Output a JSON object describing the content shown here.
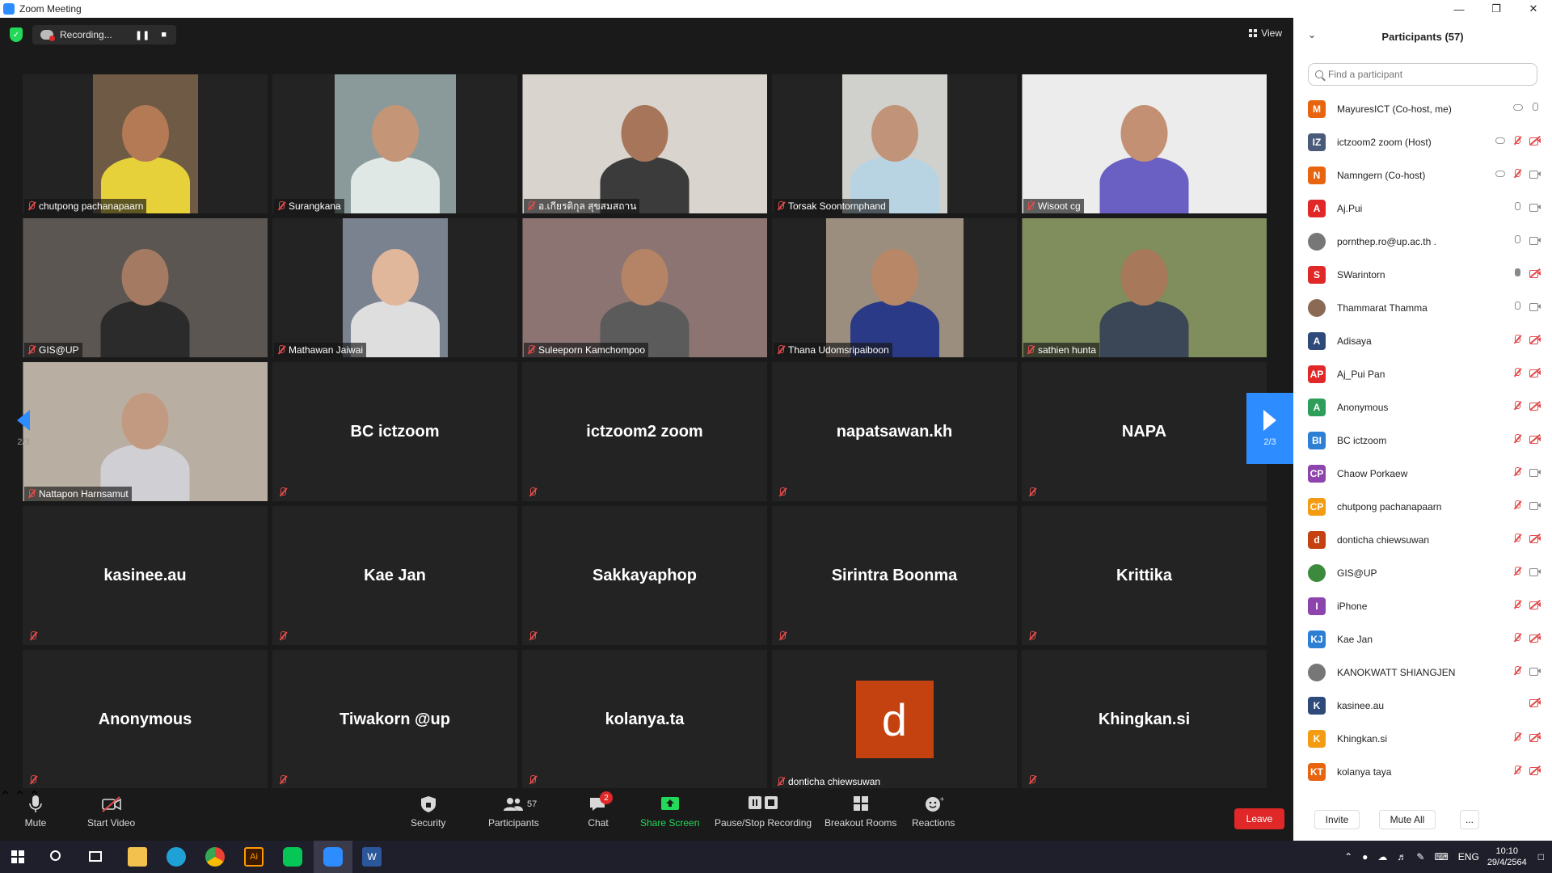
{
  "window": {
    "title": "Zoom Meeting"
  },
  "topbar": {
    "recording_label": "Recording...",
    "view_label": "View"
  },
  "pager": {
    "page": "2/3"
  },
  "tiles": [
    {
      "name": "chutpong pachanapaarn",
      "video": true,
      "bg": "#6e5a45",
      "skin": "#b37a55",
      "shirt": "#e6d13a"
    },
    {
      "name": "Surangkana",
      "video": true,
      "bg": "#8a9a9a",
      "skin": "#c49576",
      "shirt": "#dfe8e4"
    },
    {
      "name": "อ.เกียรติกุล สุขสมสถาน",
      "video": true,
      "bg": "#d9d4ce",
      "skin": "#a7765a",
      "shirt": "#3b3b3b"
    },
    {
      "name": "Torsak Soontornphand",
      "video": true,
      "bg": "#d0d0cc",
      "skin": "#c19378",
      "shirt": "#b8d4e3"
    },
    {
      "name": "Wisoot cg",
      "video": true,
      "bg": "#ececec",
      "skin": "#c49073",
      "shirt": "#6a5fc3"
    },
    {
      "name": "GIS@UP",
      "video": true,
      "bg": "#5b5652",
      "skin": "#a57a62",
      "shirt": "#2b2b2b"
    },
    {
      "name": "Mathawan Jaiwai",
      "video": true,
      "bg": "#7a8290",
      "skin": "#e0b79b",
      "shirt": "#dedede"
    },
    {
      "name": "Suleeporn Kamchompoo",
      "video": true,
      "bg": "#8b7472",
      "skin": "#b58466",
      "shirt": "#5b5b5b"
    },
    {
      "name": "Thana Udomsripaiboon",
      "video": true,
      "bg": "#9b8e7f",
      "skin": "#b88768",
      "shirt": "#2b3a86"
    },
    {
      "name": "sathien hunta",
      "video": true,
      "bg": "#7f8e5c",
      "skin": "#a8785a",
      "shirt": "#3b4656"
    },
    {
      "name": "Nattapon Harnsamut",
      "video": true,
      "bg": "#b9aea2",
      "skin": "#c29a82",
      "shirt": "#cfcfd4"
    },
    {
      "name": "BC ictzoom",
      "video": false
    },
    {
      "name": "ictzoom2 zoom",
      "video": false
    },
    {
      "name": "napatsawan.kh",
      "video": false
    },
    {
      "name": "NAPA",
      "video": false
    },
    {
      "name": "kasinee.au",
      "video": false
    },
    {
      "name": "Kae Jan",
      "video": false
    },
    {
      "name": "Sakkayaphop",
      "video": false
    },
    {
      "name": "Sirintra Boonma",
      "video": false
    },
    {
      "name": "Krittika",
      "video": false
    },
    {
      "name": "Anonymous",
      "video": false
    },
    {
      "name": "Tiwakorn @up",
      "video": false
    },
    {
      "name": "kolanya.ta",
      "video": false
    },
    {
      "name": "donticha chiewsuwan",
      "video": false,
      "avatar": "d",
      "avatar_color": "#c4420f"
    },
    {
      "name": "Khingkan.si",
      "video": false
    }
  ],
  "toolbar": {
    "mute": "Mute",
    "start_video": "Start Video",
    "security": "Security",
    "participants": "Participants",
    "participants_count": "57",
    "chat": "Chat",
    "chat_badge": "2",
    "share_screen": "Share Screen",
    "pause_recording": "Pause/Stop Recording",
    "breakout_rooms": "Breakout Rooms",
    "reactions": "Reactions",
    "leave": "Leave"
  },
  "participants_panel": {
    "title": "Participants (57)",
    "search_placeholder": "Find a participant",
    "invite": "Invite",
    "mute_all": "Mute All",
    "more": "...",
    "list": [
      {
        "initials": "M",
        "name": "MayuresICT (Co-host, me)",
        "color": "#e8650f",
        "cloud": true,
        "mic": "on",
        "cam": "none"
      },
      {
        "initials": "IZ",
        "name": "ictzoom2 zoom (Host)",
        "color": "#4a5a7a",
        "cloud": true,
        "mic": "off",
        "cam": "off"
      },
      {
        "initials": "N",
        "name": "Namngern (Co-host)",
        "color": "#e8650f",
        "cloud": true,
        "mic": "off",
        "cam": "on"
      },
      {
        "initials": "A",
        "name": "Aj.Pui",
        "color": "#e02828",
        "cloud": false,
        "mic": "on",
        "cam": "on"
      },
      {
        "initials": "",
        "name": "pornthep.ro@up.ac.th .",
        "color": "#777777",
        "photo": true,
        "cloud": false,
        "mic": "on",
        "cam": "on"
      },
      {
        "initials": "S",
        "name": "SWarintorn",
        "color": "#e02828",
        "cloud": false,
        "mic": "talk",
        "cam": "off"
      },
      {
        "initials": "",
        "name": "Thammarat Thamma",
        "color": "#8a6a55",
        "photo": true,
        "cloud": false,
        "mic": "on",
        "cam": "on"
      },
      {
        "initials": "A",
        "name": "Adisaya",
        "color": "#2d4a7a",
        "cloud": false,
        "mic": "off",
        "cam": "off"
      },
      {
        "initials": "AP",
        "name": "Aj_Pui Pan",
        "color": "#e02828",
        "cloud": false,
        "mic": "off",
        "cam": "off"
      },
      {
        "initials": "A",
        "name": "Anonymous",
        "color": "#2e9e5b",
        "cloud": false,
        "mic": "off",
        "cam": "off"
      },
      {
        "initials": "BI",
        "name": "BC ictzoom",
        "color": "#2d7fd4",
        "cloud": false,
        "mic": "off",
        "cam": "off"
      },
      {
        "initials": "CP",
        "name": "Chaow Porkaew",
        "color": "#8e44ad",
        "cloud": false,
        "mic": "off",
        "cam": "on"
      },
      {
        "initials": "CP",
        "name": "chutpong pachanapaarn",
        "color": "#f39c12",
        "cloud": false,
        "mic": "off",
        "cam": "on"
      },
      {
        "initials": "d",
        "name": "donticha chiewsuwan",
        "color": "#c4420f",
        "cloud": false,
        "mic": "off",
        "cam": "off"
      },
      {
        "initials": "",
        "name": "GIS@UP",
        "color": "#3c8a3c",
        "photo": true,
        "cloud": false,
        "mic": "off",
        "cam": "on"
      },
      {
        "initials": "I",
        "name": "iPhone",
        "color": "#8e44ad",
        "cloud": false,
        "mic": "off",
        "cam": "off"
      },
      {
        "initials": "KJ",
        "name": "Kae Jan",
        "color": "#2d7fd4",
        "cloud": false,
        "mic": "off",
        "cam": "off"
      },
      {
        "initials": "",
        "name": "KANOKWATT SHIANGJEN",
        "color": "#777777",
        "photo": true,
        "cloud": false,
        "mic": "off",
        "cam": "on"
      },
      {
        "initials": "K",
        "name": "kasinee.au",
        "color": "#2d4a7a",
        "cloud": false,
        "mic": "none",
        "cam": "off"
      },
      {
        "initials": "K",
        "name": "Khingkan.si",
        "color": "#f39c12",
        "cloud": false,
        "mic": "off",
        "cam": "off"
      },
      {
        "initials": "KT",
        "name": "kolanya taya",
        "color": "#e8650f",
        "cloud": false,
        "mic": "off",
        "cam": "off"
      }
    ]
  },
  "taskbar": {
    "language": "ENG",
    "time": "10:10",
    "date": "29/4/2564"
  },
  "colors": {
    "accent": "#2d8cff",
    "leave": "#e02828",
    "share": "#23d959"
  }
}
